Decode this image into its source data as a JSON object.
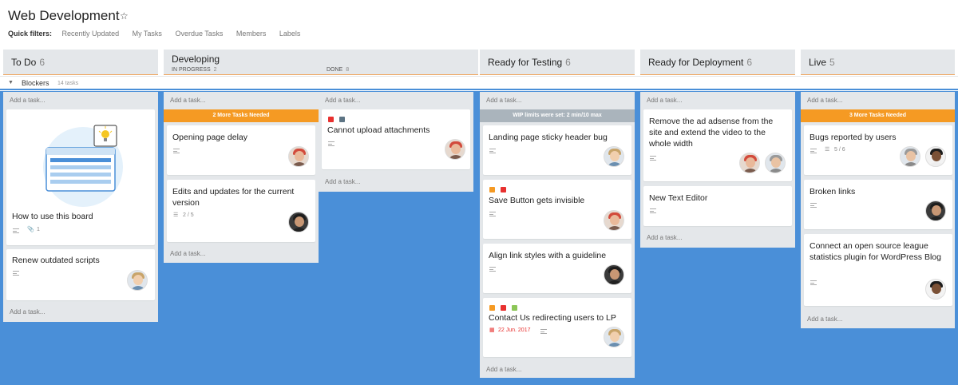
{
  "board": {
    "title": "Web Development"
  },
  "filters": {
    "label": "Quick filters:",
    "items": [
      "Recently Updated",
      "My Tasks",
      "Overdue Tasks",
      "Members",
      "Labels"
    ]
  },
  "columns": {
    "todo": {
      "name": "To Do",
      "count": "6"
    },
    "developing": {
      "name": "Developing",
      "in_progress": "IN PROGRESS",
      "in_progress_count": "2",
      "done": "DONE",
      "done_count": "8"
    },
    "testing": {
      "name": "Ready for Testing",
      "count": "6"
    },
    "deployment": {
      "name": "Ready for Deployment",
      "count": "6"
    },
    "live": {
      "name": "Live",
      "count": "5"
    }
  },
  "swimlane": {
    "name": "Blockers",
    "count": "14 tasks"
  },
  "add_task": "Add a task...",
  "banners": {
    "in_progress": "2 More Tasks Needed",
    "testing": "WIP limits were set: 2 min/10 max",
    "live": "3 More Tasks Needed"
  },
  "cards": {
    "todo_1": {
      "title": "How to use this board",
      "attachments": "1"
    },
    "todo_2": {
      "title": "Renew outdated scripts"
    },
    "inprog_1": {
      "title": "Opening page delay"
    },
    "inprog_2": {
      "title": "Edits and updates for the current version",
      "checklist": "2 / 5"
    },
    "done_1": {
      "title": "Cannot upload attachments"
    },
    "test_1": {
      "title": "Landing page sticky header bug"
    },
    "test_2": {
      "title": "Save Button gets invisible"
    },
    "test_3": {
      "title": "Align link styles with a guideline"
    },
    "test_4": {
      "title": "Contact Us redirecting users to LP",
      "due": "22 Jun. 2017"
    },
    "deploy_1": {
      "title": "Remove the ad adsense from the site and extend the video to the whole width"
    },
    "deploy_2": {
      "title": "New Text Editor"
    },
    "live_1": {
      "title": "Bugs reported by users",
      "checklist": "5 / 6"
    },
    "live_2": {
      "title": "Broken links"
    },
    "live_3": {
      "title": "Connect an open source league statistics plugin for WordPress Blog"
    }
  },
  "colors": {
    "background": "#4a8fd8",
    "lane": "#e4e7ea",
    "accent_orange": "#f59a23",
    "tag_red": "#e8312f",
    "tag_orange": "#f59a23",
    "tag_green": "#8cc657",
    "tag_slate": "#5d7484"
  },
  "icons": [
    "star-icon",
    "collapse-arrow-icon",
    "description-icon",
    "attachment-icon",
    "checklist-icon",
    "calendar-icon"
  ]
}
